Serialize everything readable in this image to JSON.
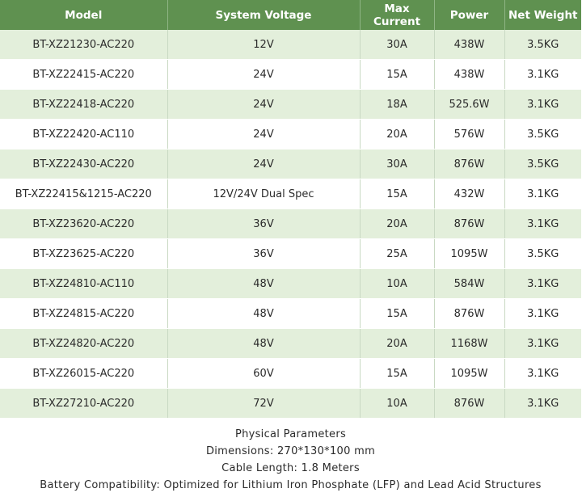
{
  "table": {
    "headers": [
      "Model",
      "System Voltage",
      "Max Current",
      "Power",
      "Net Weight"
    ],
    "rows": [
      [
        "BT-XZ21230-AC220",
        "12V",
        "30A",
        "438W",
        "3.5KG"
      ],
      [
        "BT-XZ22415-AC220",
        "24V",
        "15A",
        "438W",
        "3.1KG"
      ],
      [
        "BT-XZ22418-AC220",
        "24V",
        "18A",
        "525.6W",
        "3.1KG"
      ],
      [
        "BT-XZ22420-AC110",
        "24V",
        "20A",
        "576W",
        "3.5KG"
      ],
      [
        "BT-XZ22430-AC220",
        "24V",
        "30A",
        "876W",
        "3.5KG"
      ],
      [
        "BT-XZ22415&1215-AC220",
        "12V/24V Dual Spec",
        "15A",
        "432W",
        "3.1KG"
      ],
      [
        "BT-XZ23620-AC220",
        "36V",
        "20A",
        "876W",
        "3.1KG"
      ],
      [
        "BT-XZ23625-AC220",
        "36V",
        "25A",
        "1095W",
        "3.5KG"
      ],
      [
        "BT-XZ24810-AC110",
        "48V",
        "10A",
        "584W",
        "3.1KG"
      ],
      [
        "BT-XZ24815-AC220",
        "48V",
        "15A",
        "876W",
        "3.1KG"
      ],
      [
        "BT-XZ24820-AC220",
        "48V",
        "20A",
        "1168W",
        "3.1KG"
      ],
      [
        "BT-XZ26015-AC220",
        "60V",
        "15A",
        "1095W",
        "3.1KG"
      ],
      [
        "BT-XZ27210-AC220",
        "72V",
        "10A",
        "876W",
        "3.1KG"
      ]
    ]
  },
  "footer": {
    "title": "Physical Parameters",
    "dimensions": "Dimensions: 270*130*100 mm",
    "cable": "Cable Length: 1.8 Meters",
    "compatibility": "Battery Compatibility: Optimized for Lithium Iron Phosphate (LFP) and Lead Acid Structures"
  },
  "colors": {
    "header_bg": "#5f9150",
    "stripe_bg": "#e3efdb",
    "text": "#2b2b2b"
  }
}
